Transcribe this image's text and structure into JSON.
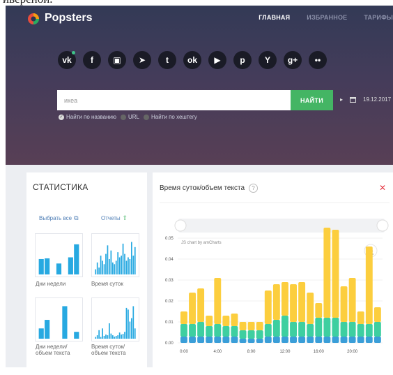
{
  "clipped_top_text": "ивереной.",
  "app": {
    "brand": "Popsters",
    "nav": [
      {
        "label": "ГЛАВНАЯ",
        "active": true
      },
      {
        "label": "ИЗБРАННОЕ",
        "active": false
      },
      {
        "label": "ТАРИФЫ",
        "active": false
      }
    ]
  },
  "social_networks": [
    {
      "icon": "vk-icon",
      "glyph": "vk",
      "badge": true
    },
    {
      "icon": "facebook-icon",
      "glyph": "f",
      "badge": false
    },
    {
      "icon": "instagram-icon",
      "glyph": "▣",
      "badge": false
    },
    {
      "icon": "telegram-icon",
      "glyph": "➤",
      "badge": false
    },
    {
      "icon": "twitter-icon",
      "glyph": "t",
      "badge": false
    },
    {
      "icon": "odnoklassniki-icon",
      "glyph": "ok",
      "badge": false
    },
    {
      "icon": "youtube-icon",
      "glyph": "▶",
      "badge": false
    },
    {
      "icon": "pinterest-icon",
      "glyph": "p",
      "badge": false
    },
    {
      "icon": "yammer-icon",
      "glyph": "Y",
      "badge": false
    },
    {
      "icon": "google-plus-icon",
      "glyph": "g+",
      "badge": false
    },
    {
      "icon": "flickr-icon",
      "glyph": "••",
      "badge": false
    }
  ],
  "search": {
    "value": "икеа",
    "button": "НАЙТИ",
    "date": "19.12.2017",
    "options": [
      {
        "label": "Найти по названию",
        "checked": true
      },
      {
        "label": "URL",
        "checked": false
      },
      {
        "label": "Найти по хештегу",
        "checked": false
      }
    ]
  },
  "stats": {
    "title": "СТАТИСТИКА",
    "select_all": "Выбрать все",
    "reports": "Отчеты",
    "charts": [
      {
        "label_1": "Дни недели",
        "label_2": "",
        "values": [
          0.45,
          0.47,
          0.0,
          0.32,
          0.0,
          0.5,
          0.88
        ]
      },
      {
        "label_1": "Время суток",
        "label_2": "",
        "values": [
          0.15,
          0.35,
          0.2,
          0.55,
          0.4,
          0.3,
          0.6,
          0.85,
          0.45,
          0.7,
          0.35,
          0.3,
          0.4,
          0.65,
          0.5,
          0.55,
          0.9,
          0.6,
          0.4,
          0.5,
          0.45,
          0.95,
          0.55,
          0.8
        ]
      },
      {
        "label_1": "Дни недели/",
        "label_2": "объем текста",
        "values": [
          0.3,
          0.55,
          0.0,
          0.0,
          0.95,
          0.0,
          0.2
        ]
      },
      {
        "label_1": "Время суток/",
        "label_2": "объем текста",
        "values": [
          0.05,
          0.1,
          0.25,
          0.05,
          0.3,
          0.08,
          0.12,
          0.1,
          0.45,
          0.15,
          0.1,
          0.06,
          0.08,
          0.1,
          0.18,
          0.12,
          0.14,
          0.2,
          0.9,
          0.85,
          0.5,
          0.6,
          0.95,
          0.3
        ]
      }
    ]
  },
  "main_chart": {
    "title": "Время суток/объем текста",
    "watermark": "JS chart by amCharts",
    "colors": {
      "total": "#fcce3e",
      "mid": "#3ecfa0",
      "base": "#3a9ed8"
    }
  },
  "chart_data": {
    "type": "bar",
    "stacked": true,
    "x_ticks": [
      "0:00",
      "4:00",
      "8:00",
      "12:00",
      "16:00",
      "20:00"
    ],
    "y_ticks": [
      "0.00",
      "0.01",
      "0.02",
      "0.03",
      "0.04",
      "0.05"
    ],
    "ylim": [
      0,
      0.05
    ],
    "x": [
      "0:00",
      "1:00",
      "2:00",
      "3:00",
      "4:00",
      "5:00",
      "6:00",
      "7:00",
      "8:00",
      "9:00",
      "10:00",
      "11:00",
      "12:00",
      "13:00",
      "14:00",
      "15:00",
      "16:00",
      "17:00",
      "18:00",
      "19:00",
      "20:00",
      "21:00",
      "22:00",
      "23:00"
    ],
    "series": [
      {
        "values": [
          0.003,
          0.003,
          0.003,
          0.003,
          0.003,
          0.003,
          0.003,
          0.002,
          0.002,
          0.002,
          0.003,
          0.003,
          0.003,
          0.003,
          0.003,
          0.003,
          0.003,
          0.003,
          0.003,
          0.003,
          0.003,
          0.003,
          0.003,
          0.003
        ]
      },
      {
        "values": [
          0.006,
          0.006,
          0.007,
          0.005,
          0.006,
          0.005,
          0.005,
          0.004,
          0.004,
          0.004,
          0.006,
          0.008,
          0.01,
          0.007,
          0.007,
          0.006,
          0.009,
          0.009,
          0.009,
          0.007,
          0.007,
          0.006,
          0.006,
          0.007
        ]
      },
      {
        "values": [
          0.006,
          0.015,
          0.016,
          0.005,
          0.022,
          0.005,
          0.006,
          0.004,
          0.004,
          0.004,
          0.016,
          0.017,
          0.016,
          0.018,
          0.019,
          0.015,
          0.007,
          0.043,
          0.042,
          0.017,
          0.021,
          0.006,
          0.037,
          0.007
        ]
      }
    ]
  }
}
